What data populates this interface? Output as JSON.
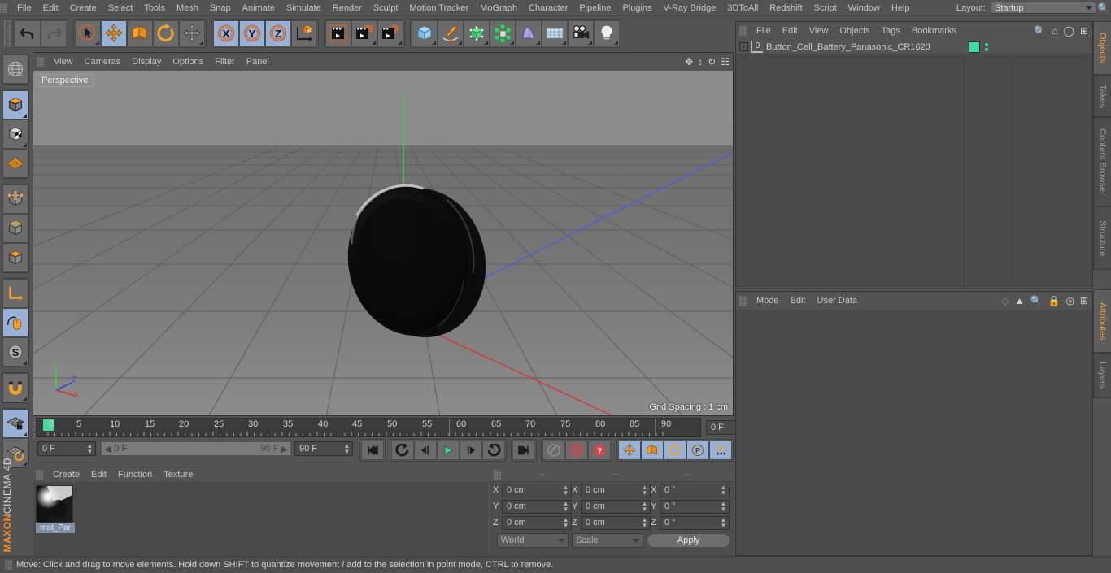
{
  "app": {
    "title": "CINEMA 4D",
    "brand_prefix": "MAXON",
    "brand_name": "CINEMA 4D"
  },
  "menubar": {
    "items": [
      {
        "label": "File"
      },
      {
        "label": "Edit"
      },
      {
        "label": "Create"
      },
      {
        "label": "Select"
      },
      {
        "label": "Tools"
      },
      {
        "label": "Mesh"
      },
      {
        "label": "Snap"
      },
      {
        "label": "Animate"
      },
      {
        "label": "Simulate"
      },
      {
        "label": "Render"
      },
      {
        "label": "Sculpt"
      },
      {
        "label": "Motion Tracker"
      },
      {
        "label": "MoGraph"
      },
      {
        "label": "Character"
      },
      {
        "label": "Pipeline"
      },
      {
        "label": "Plugins"
      },
      {
        "label": "V-Ray Bridge"
      },
      {
        "label": "3DToAll"
      },
      {
        "label": "Redshift"
      },
      {
        "label": "Script"
      },
      {
        "label": "Window"
      },
      {
        "label": "Help"
      }
    ],
    "layout_label": "Layout:",
    "layout_value": "Startup",
    "search_icon": "search-icon"
  },
  "toolbar": {
    "groups": [
      {
        "name": "history",
        "buttons": [
          {
            "name": "undo-button",
            "icon": "undo-icon",
            "active": false
          },
          {
            "name": "redo-button",
            "icon": "redo-icon",
            "active": false
          }
        ]
      },
      {
        "name": "transform",
        "buttons": [
          {
            "name": "live-selection-button",
            "icon": "selection-cursor-icon",
            "active": false
          },
          {
            "name": "move-button",
            "icon": "move-arrows-icon",
            "active": true
          },
          {
            "name": "scale-button",
            "icon": "scale-box-icon",
            "active": false
          },
          {
            "name": "rotate-button",
            "icon": "rotate-arc-icon",
            "active": false
          },
          {
            "name": "move-duplicate-button",
            "icon": "move-arrows-icon",
            "active": false
          }
        ]
      },
      {
        "name": "axis-locks",
        "buttons": [
          {
            "name": "lock-x-button",
            "icon": "axis-x-icon",
            "active": true
          },
          {
            "name": "lock-y-button",
            "icon": "axis-y-icon",
            "active": true
          },
          {
            "name": "lock-z-button",
            "icon": "axis-z-icon",
            "active": true
          },
          {
            "name": "world-object-coordinates-button",
            "icon": "world-axis-icon",
            "active": false
          }
        ]
      },
      {
        "name": "render",
        "buttons": [
          {
            "name": "render-view-button",
            "icon": "clapperboard-icon",
            "active": false
          },
          {
            "name": "render-to-picture-viewer-button",
            "icon": "clapperboard-picture-icon",
            "active": false
          },
          {
            "name": "render-settings-button",
            "icon": "clapperboard-gear-icon",
            "active": false
          }
        ]
      },
      {
        "name": "create-objects",
        "buttons": [
          {
            "name": "add-cube-button",
            "icon": "cube-icon",
            "active": false
          },
          {
            "name": "add-spline-button",
            "icon": "pen-spline-icon",
            "active": false
          },
          {
            "name": "add-generator-button",
            "icon": "green-cube-icon",
            "active": false
          },
          {
            "name": "add-array-button",
            "icon": "array-cluster-icon",
            "active": false
          },
          {
            "name": "add-deformer-button",
            "icon": "bend-deformer-icon",
            "active": false
          },
          {
            "name": "add-environment-button",
            "icon": "floor-grid-icon",
            "active": false
          },
          {
            "name": "add-camera-button",
            "icon": "camera-icon",
            "active": false
          },
          {
            "name": "add-light-button",
            "icon": "light-bulb-icon",
            "active": false
          }
        ]
      }
    ]
  },
  "left_toolbar": {
    "buttons": [
      {
        "name": "undo-view-button",
        "icon": "globe-wire-icon",
        "active": false
      },
      {
        "name": "model-mode-button",
        "icon": "model-cube-icon",
        "active": true
      },
      {
        "name": "texture-mode-button",
        "icon": "texture-checker-cube-icon",
        "active": false
      },
      {
        "name": "uv-polygon-mode-button",
        "icon": "uv-mesh-icon",
        "active": false
      },
      {
        "name": "point-mode-button",
        "icon": "points-cube-icon",
        "active": false
      },
      {
        "name": "edge-mode-button",
        "icon": "edge-cube-icon",
        "active": false
      },
      {
        "name": "polygon-mode-button",
        "icon": "polygon-cube-icon",
        "active": false
      },
      {
        "name": "axis-mode-button",
        "icon": "axis-corner-icon",
        "active": false
      },
      {
        "name": "enable-tweak-button",
        "icon": "mouse-tweak-icon",
        "active": true
      },
      {
        "name": "soft-selection-button",
        "icon": "soft-selection-s-icon",
        "active": false
      },
      {
        "name": "snap-magnet-button",
        "icon": "magnet-icon",
        "active": false
      },
      {
        "name": "workplane-lock-button",
        "icon": "workplane-lock-icon",
        "active": true
      },
      {
        "name": "workplane-rotate-button",
        "icon": "workplane-rotate-icon",
        "active": false
      }
    ]
  },
  "viewport": {
    "menu": [
      {
        "label": "View"
      },
      {
        "label": "Cameras"
      },
      {
        "label": "Display"
      },
      {
        "label": "Options"
      },
      {
        "label": "Filter"
      },
      {
        "label": "Panel"
      }
    ],
    "view_label": "Perspective",
    "grid_spacing": "Grid Spacing : 1 cm",
    "nav_icons": [
      "pan-icon",
      "zoom-icon",
      "rotate-icon",
      "maximize-icon"
    ],
    "axis_labels": {
      "x": "X",
      "y": "Y",
      "z": "Z"
    },
    "axis_colors": {
      "x": "#d0423a",
      "y": "#4cc24c",
      "z": "#4a5fd8"
    },
    "object_name": "button-cell-battery-mesh"
  },
  "timeline": {
    "ruler_labels": [
      "0",
      "5",
      "10",
      "15",
      "20",
      "25",
      "30",
      "35",
      "40",
      "45",
      "50",
      "55",
      "60",
      "65",
      "70",
      "75",
      "80",
      "85",
      "90"
    ],
    "ruler_min": 0,
    "ruler_max": 90,
    "current_frame_marker": "0",
    "current_frame_field": "0 F",
    "start_frame_field": "0 F",
    "range_start": "0 F",
    "range_end": "90 F",
    "end_frame_field": "90 F",
    "playback_buttons": [
      {
        "name": "go-to-start-button",
        "icon": "skip-start-icon"
      },
      {
        "name": "go-to-previous-keyframe-button",
        "icon": "prev-key-icon"
      },
      {
        "name": "step-back-button",
        "icon": "step-back-icon"
      },
      {
        "name": "play-button",
        "icon": "play-icon"
      },
      {
        "name": "step-forward-button",
        "icon": "step-forward-icon"
      },
      {
        "name": "go-to-next-keyframe-button",
        "icon": "next-key-icon"
      },
      {
        "name": "go-to-end-button",
        "icon": "skip-end-icon"
      }
    ],
    "record_buttons": [
      {
        "name": "record-active-objects-button",
        "icon": "record-key-icon",
        "active": false
      },
      {
        "name": "autokeying-button",
        "icon": "autokey-circle-icon",
        "active": false
      },
      {
        "name": "keyframe-selection-button",
        "icon": "key-question-icon",
        "active": false
      }
    ],
    "key_toggles": [
      {
        "name": "position-key-button",
        "icon": "position-arrows-icon",
        "active": true
      },
      {
        "name": "scale-key-button",
        "icon": "scale-box-icon",
        "active": true
      },
      {
        "name": "rotation-key-button",
        "icon": "rotate-arc-icon",
        "active": true
      },
      {
        "name": "parameter-key-button",
        "icon": "param-p-icon",
        "active": true
      },
      {
        "name": "point-level-animation-button",
        "icon": "pla-dots-icon",
        "active": true
      }
    ],
    "timeline_toggle": {
      "name": "animation-mode-button",
      "icon": "film-strip-icon",
      "active": true
    }
  },
  "material_manager": {
    "menu": [
      {
        "label": "Create"
      },
      {
        "label": "Edit"
      },
      {
        "label": "Function"
      },
      {
        "label": "Texture"
      }
    ],
    "materials": [
      {
        "name": "mat_Par",
        "swatch": "material-sphere-preview"
      }
    ]
  },
  "coordinates": {
    "headers": [
      "--",
      "--",
      "--"
    ],
    "position": {
      "label_x": "X",
      "label_y": "Y",
      "label_z": "Z",
      "x": "0 cm",
      "y": "0 cm",
      "z": "0 cm"
    },
    "size": {
      "label_x": "X",
      "label_y": "Y",
      "label_z": "Z",
      "x": "0 cm",
      "y": "0 cm",
      "z": "0 cm"
    },
    "rotation": {
      "label_x": "X",
      "label_y": "Y",
      "label_z": "Z",
      "x": "0 °",
      "y": "0 °",
      "z": "0 °"
    },
    "coord_system": "World",
    "transform_mode": "Scale",
    "apply_label": "Apply"
  },
  "object_manager": {
    "menu": [
      {
        "label": "File"
      },
      {
        "label": "Edit"
      },
      {
        "label": "View"
      },
      {
        "label": "Objects"
      },
      {
        "label": "Tags"
      },
      {
        "label": "Bookmarks"
      }
    ],
    "tools": [
      "search-icon",
      "home-icon",
      "ellipse-icon",
      "add-panel-icon"
    ],
    "objects": [
      {
        "name": "Button_Cell_Battery_Panasonic_CR1620",
        "expand": "+",
        "type_icon": "null-object-icon",
        "tag_color": "#3ddba0",
        "visibility_dots": 2
      }
    ]
  },
  "attributes_manager": {
    "menu": [
      {
        "label": "Mode"
      },
      {
        "label": "Edit"
      },
      {
        "label": "User Data"
      }
    ],
    "tools": [
      "layers-icon",
      "arrow-up-icon",
      "search-icon",
      "lock-icon",
      "target-icon",
      "add-panel-icon"
    ],
    "content": ""
  },
  "side_tabs": {
    "upper": [
      {
        "label": "Objects",
        "selected": true
      },
      {
        "label": "Takes",
        "selected": false
      },
      {
        "label": "Content Browser",
        "selected": false
      },
      {
        "label": "Structure",
        "selected": false
      }
    ],
    "lower": [
      {
        "label": "Attributes",
        "selected": true
      },
      {
        "label": "Layers",
        "selected": false
      }
    ]
  },
  "statusbar": {
    "message": "Move: Click and drag to move elements. Hold down SHIFT to quantize movement / add to the selection in point mode, CTRL to remove."
  },
  "colors": {
    "panel_bg": "#535353",
    "dark_panel": "#4a4a4a",
    "viewport_bg": "#6e6e6e",
    "accent_orange": "#ff8a1e",
    "accent_blue": "#97b2d6",
    "green_tag": "#3ddba0",
    "axis_x": "#d0423a",
    "axis_y": "#4cc24c",
    "axis_z": "#4a5fd8"
  }
}
